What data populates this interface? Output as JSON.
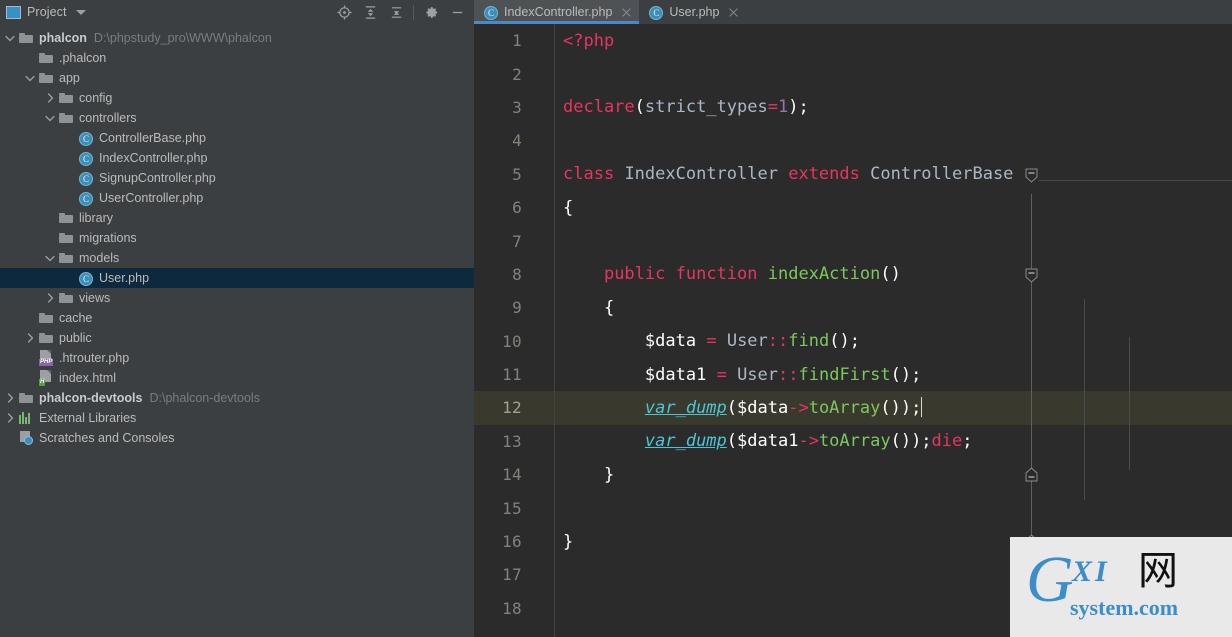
{
  "sidebar": {
    "title": "Project",
    "icons": [
      "project-icon",
      "chevron-down-icon",
      "locate-icon",
      "expand-all-icon",
      "collapse-all-icon",
      "gear-icon",
      "minimize-icon"
    ],
    "tree": [
      {
        "label": "phalcon",
        "path": "D:\\phpstudy_pro\\WWW\\phalcon",
        "depth": 0,
        "icon": "folder",
        "arrow": "down",
        "bold": true,
        "selected": false
      },
      {
        "label": ".phalcon",
        "path": "",
        "depth": 1,
        "icon": "folder",
        "arrow": "none",
        "bold": false,
        "selected": false
      },
      {
        "label": "app",
        "path": "",
        "depth": 1,
        "icon": "folder",
        "arrow": "down",
        "bold": false,
        "selected": false
      },
      {
        "label": "config",
        "path": "",
        "depth": 2,
        "icon": "folder",
        "arrow": "right",
        "bold": false,
        "selected": false
      },
      {
        "label": "controllers",
        "path": "",
        "depth": 2,
        "icon": "folder",
        "arrow": "down",
        "bold": false,
        "selected": false
      },
      {
        "label": "ControllerBase.php",
        "path": "",
        "depth": 3,
        "icon": "php-class",
        "arrow": "none",
        "bold": false,
        "selected": false
      },
      {
        "label": "IndexController.php",
        "path": "",
        "depth": 3,
        "icon": "php-class",
        "arrow": "none",
        "bold": false,
        "selected": false
      },
      {
        "label": "SignupController.php",
        "path": "",
        "depth": 3,
        "icon": "php-class",
        "arrow": "none",
        "bold": false,
        "selected": false
      },
      {
        "label": "UserController.php",
        "path": "",
        "depth": 3,
        "icon": "php-class",
        "arrow": "none",
        "bold": false,
        "selected": false
      },
      {
        "label": "library",
        "path": "",
        "depth": 2,
        "icon": "folder",
        "arrow": "none",
        "bold": false,
        "selected": false
      },
      {
        "label": "migrations",
        "path": "",
        "depth": 2,
        "icon": "folder",
        "arrow": "none",
        "bold": false,
        "selected": false
      },
      {
        "label": "models",
        "path": "",
        "depth": 2,
        "icon": "folder",
        "arrow": "down",
        "bold": false,
        "selected": false
      },
      {
        "label": "User.php",
        "path": "",
        "depth": 3,
        "icon": "php-class",
        "arrow": "none",
        "bold": false,
        "selected": true
      },
      {
        "label": "views",
        "path": "",
        "depth": 2,
        "icon": "folder",
        "arrow": "right",
        "bold": false,
        "selected": false
      },
      {
        "label": "cache",
        "path": "",
        "depth": 1,
        "icon": "folder",
        "arrow": "none",
        "bold": false,
        "selected": false
      },
      {
        "label": "public",
        "path": "",
        "depth": 1,
        "icon": "folder",
        "arrow": "right",
        "bold": false,
        "selected": false
      },
      {
        "label": ".htrouter.php",
        "path": "",
        "depth": 1,
        "icon": "php-file",
        "arrow": "none",
        "bold": false,
        "selected": false
      },
      {
        "label": "index.html",
        "path": "",
        "depth": 1,
        "icon": "html-file",
        "arrow": "none",
        "bold": false,
        "selected": false
      },
      {
        "label": "phalcon-devtools",
        "path": "D:\\phalcon-devtools",
        "depth": 0,
        "icon": "folder",
        "arrow": "right",
        "bold": true,
        "selected": false
      },
      {
        "label": "External Libraries",
        "path": "",
        "depth": 0,
        "icon": "ext-libraries",
        "arrow": "right",
        "bold": false,
        "selected": false
      },
      {
        "label": "Scratches and Consoles",
        "path": "",
        "depth": 0,
        "icon": "scratches",
        "arrow": "none",
        "bold": false,
        "selected": false
      }
    ]
  },
  "editor": {
    "tabs": [
      {
        "label": "IndexController.php",
        "active": true,
        "icon": "php-class-icon",
        "close": "close-icon"
      },
      {
        "label": "User.php",
        "active": false,
        "icon": "php-class-icon",
        "close": "close-icon"
      }
    ],
    "current_line": 12,
    "line_numbers": [
      1,
      2,
      3,
      4,
      5,
      6,
      7,
      8,
      9,
      10,
      11,
      12,
      13,
      14,
      15,
      16,
      17,
      18
    ],
    "lines": [
      {
        "n": 1,
        "text": "<?php"
      },
      {
        "n": 2,
        "text": ""
      },
      {
        "n": 3,
        "text": "declare(strict_types=1);"
      },
      {
        "n": 4,
        "text": ""
      },
      {
        "n": 5,
        "text": "class IndexController extends ControllerBase"
      },
      {
        "n": 6,
        "text": "{"
      },
      {
        "n": 7,
        "text": ""
      },
      {
        "n": 8,
        "text": "    public function indexAction()"
      },
      {
        "n": 9,
        "text": "    {"
      },
      {
        "n": 10,
        "text": "        $data = User::find();"
      },
      {
        "n": 11,
        "text": "        $data1 = User::findFirst();"
      },
      {
        "n": 12,
        "text": "        var_dump($data->toArray());"
      },
      {
        "n": 13,
        "text": "        var_dump($data1->toArray());die;"
      },
      {
        "n": 14,
        "text": "    }"
      },
      {
        "n": 15,
        "text": ""
      },
      {
        "n": 16,
        "text": "}"
      },
      {
        "n": 17,
        "text": ""
      },
      {
        "n": 18,
        "text": ""
      }
    ]
  },
  "watermark": {
    "g": "G",
    "xi": "XI",
    "cn": "网",
    "system": "system.com"
  },
  "colors": {
    "accent_blue": "#4a88c7",
    "keyword_pink": "#e8345f",
    "function_green": "#7bc95b",
    "builtin_cyan": "#4cc6d6",
    "number_purple": "#9876aa",
    "editor_bg": "#2b2b2b",
    "panel_bg": "#3c3f41",
    "selection_navy": "#0d293e",
    "current_line": "#3a392e"
  }
}
